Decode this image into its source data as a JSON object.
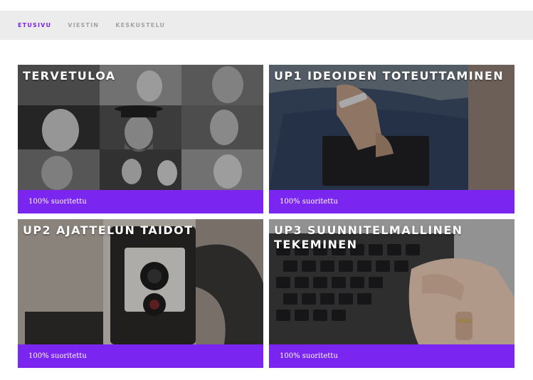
{
  "nav": {
    "items": [
      {
        "label": "ETUSIVU",
        "active": true
      },
      {
        "label": "VIESTIN",
        "active": false
      },
      {
        "label": "KESKUSTELU",
        "active": false
      }
    ]
  },
  "colors": {
    "accent": "#7a26f0",
    "nav_active": "#7a26e8",
    "nav_inactive": "#a3a3a3",
    "topbar_bg": "#ececec"
  },
  "cards": [
    {
      "title": "TERVETULOA",
      "status": "100% suoritettu",
      "image": "portrait-grid-photo",
      "progress": 100
    },
    {
      "title": "UP1 IDEOIDEN TOTEUTTAMINEN",
      "status": "100% suoritettu",
      "image": "person-with-notebook-photo",
      "progress": 100
    },
    {
      "title": "UP2 AJATTELUN TAIDOT",
      "status": "100% suoritettu",
      "image": "vintage-camera-photo",
      "progress": 100
    },
    {
      "title": "UP3 SUUNNITELMALLINEN TEKEMINEN",
      "status": "100% suoritettu",
      "image": "laptop-keyboard-photo",
      "progress": 100
    }
  ]
}
